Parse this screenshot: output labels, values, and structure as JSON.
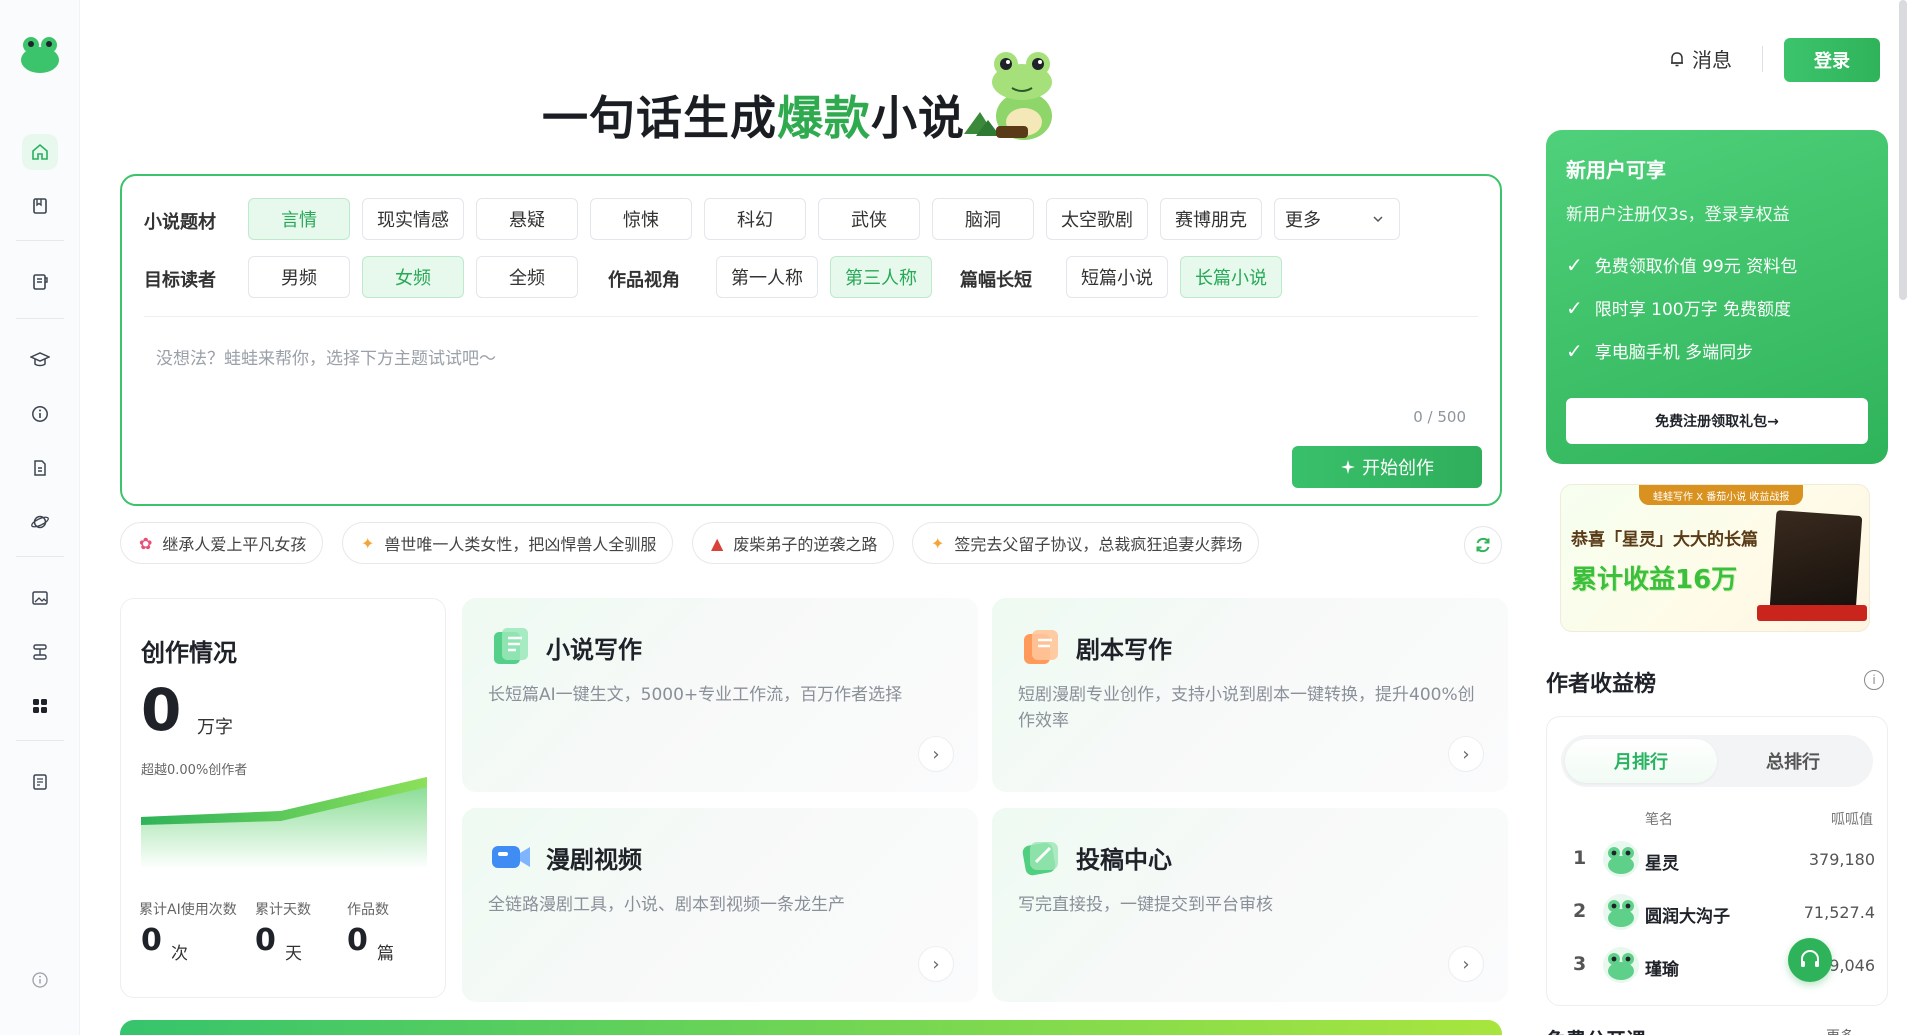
{
  "sidebar": {
    "items": [
      {
        "icon": "home-icon"
      },
      {
        "icon": "book-icon"
      },
      {
        "icon": "notebook-icon"
      },
      {
        "icon": "graduation-cap-icon"
      },
      {
        "icon": "info-icon"
      },
      {
        "icon": "document-icon"
      },
      {
        "icon": "planet-icon"
      },
      {
        "icon": "image-edit-icon"
      },
      {
        "icon": "workflow-icon"
      },
      {
        "icon": "apps-grid-icon"
      },
      {
        "icon": "contract-icon"
      }
    ],
    "bottom_icon": "info-icon"
  },
  "header": {
    "title_pre": "一句话生成",
    "title_highlight": "爆款",
    "title_post": "小说",
    "messages_label": "消息",
    "login_label": "登录"
  },
  "creator": {
    "genre_label": "小说题材",
    "genres": [
      "言情",
      "现实情感",
      "悬疑",
      "惊悚",
      "科幻",
      "武侠",
      "脑洞",
      "太空歌剧",
      "赛博朋克"
    ],
    "genre_selected": "言情",
    "more_label": "更多",
    "reader_label": "目标读者",
    "readers": [
      "男频",
      "女频",
      "全频"
    ],
    "reader_selected": "女频",
    "pov_label": "作品视角",
    "povs": [
      "第一人称",
      "第三人称"
    ],
    "pov_selected": "第三人称",
    "length_label": "篇幅长短",
    "lengths": [
      "短篇小说",
      "长篇小说"
    ],
    "length_selected": "长篇小说",
    "prompt_placeholder": "没想法？蛙蛙来帮你，选择下方主题试试吧～",
    "counter": "0 / 500",
    "start_label": "开始创作"
  },
  "suggestions": [
    {
      "text": "继承人爱上平凡女孩",
      "icon": "flower-icon"
    },
    {
      "text": "兽世唯一人类女性，把凶悍兽人全驯服",
      "icon": "sparkle-icon"
    },
    {
      "text": "废柴弟子的逆袭之路",
      "icon": "pagoda-icon"
    },
    {
      "text": "签完去父留子协议，总裁疯狂追妻火葬场",
      "icon": "sparkle-icon"
    }
  ],
  "stats": {
    "title": "创作情况",
    "value": "0",
    "unit": "万字",
    "beyond": "超越0.00%创作者",
    "items": [
      {
        "label": "累计AI使用次数",
        "value": "0",
        "unit": "次"
      },
      {
        "label": "累计天数",
        "value": "0",
        "unit": "天"
      },
      {
        "label": "作品数",
        "value": "0",
        "unit": "篇"
      }
    ]
  },
  "features": [
    {
      "title": "小说写作",
      "desc": "长短篇AI一键生文，5000+专业工作流，百万作者选择",
      "icon": "novel-writing-icon"
    },
    {
      "title": "剧本写作",
      "desc": "短剧漫剧专业创作，支持小说到剧本一键转换，提升400%创作效率",
      "icon": "script-writing-icon"
    },
    {
      "title": "漫剧视频",
      "desc": "全链路漫剧工具，小说、剧本到视频一条龙生产",
      "icon": "video-camera-icon"
    },
    {
      "title": "投稿中心",
      "desc": "写完直接投，一键提交到平台审核",
      "icon": "submit-icon"
    }
  ],
  "promo": {
    "title": "新用户可享",
    "subtitle": "新用户注册仅3s，登录享权益",
    "benefits": [
      "免费领取价值 99元 资料包",
      "限时享 100万字 免费额度",
      "享电脑手机 多端同步"
    ],
    "cta": "免费注册领取礼包→"
  },
  "banner": {
    "tag": "蛙蛙写作 X 番茄小说 收益战报",
    "line1": "恭喜「星灵」大大的长篇",
    "line2": "累计收益16万"
  },
  "ranking": {
    "title": "作者收益榜",
    "tabs": [
      "月排行",
      "总排行"
    ],
    "col_name": "笔名",
    "col_value": "呱呱值",
    "rows": [
      {
        "rank": "1",
        "name": "星灵",
        "value": "379,180"
      },
      {
        "rank": "2",
        "name": "圆润大沟子",
        "value": "71,527.4"
      },
      {
        "rank": "3",
        "name": "瑾瑜",
        "value": "9,046"
      }
    ]
  },
  "free_class": {
    "title": "免费公开课",
    "more": "更多"
  },
  "colors": {
    "brand_green": "#2fb35a",
    "selected_chip_bg": "#e7f8ed",
    "text_dark": "#1f2329"
  }
}
